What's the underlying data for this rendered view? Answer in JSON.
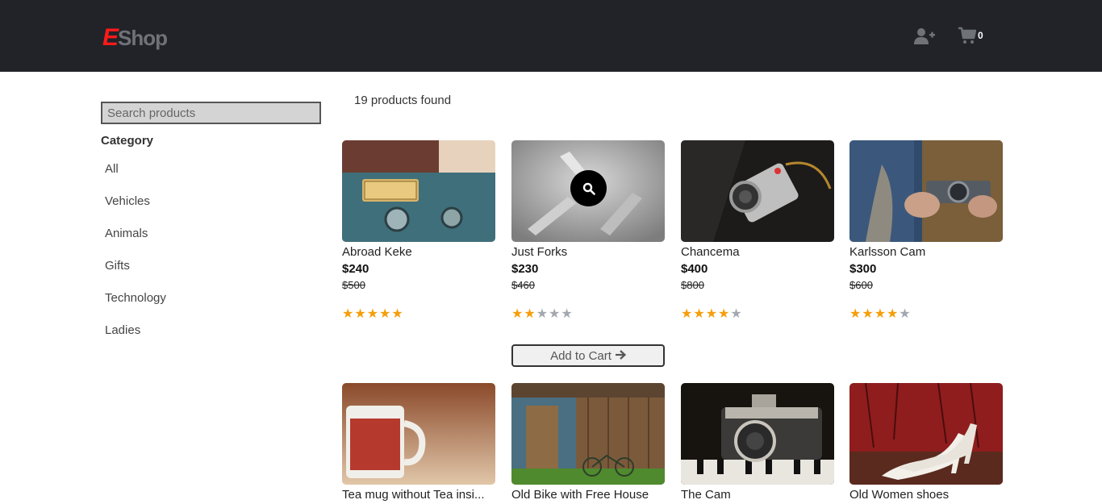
{
  "header": {
    "logo_e": "E",
    "logo_rest": "Shop",
    "cart_count": "0",
    "user_icon": "user-plus-icon",
    "cart_icon": "cart-icon"
  },
  "sidebar": {
    "search_placeholder": "Search products",
    "category_title": "Category",
    "categories": [
      "All",
      "Vehicles",
      "Animals",
      "Gifts",
      "Technology",
      "Ladies"
    ]
  },
  "main": {
    "products_found": "19 products found",
    "add_to_cart_label": "Add to Cart",
    "products": [
      {
        "name": "Abroad Keke",
        "price": "$240",
        "old_price": "$500",
        "rating": 5
      },
      {
        "name": "Just Forks",
        "price": "$230",
        "old_price": "$460",
        "rating": 2
      },
      {
        "name": "Chancema",
        "price": "$400",
        "old_price": "$800",
        "rating": 4
      },
      {
        "name": "Karlsson Cam",
        "price": "$300",
        "old_price": "$600",
        "rating": 4
      },
      {
        "name": "Tea mug without Tea insi...",
        "price": "",
        "old_price": "",
        "rating": 0
      },
      {
        "name": "Old Bike with Free House",
        "price": "",
        "old_price": "",
        "rating": 0
      },
      {
        "name": "The Cam",
        "price": "",
        "old_price": "",
        "rating": 0
      },
      {
        "name": "Old Women shoes",
        "price": "",
        "old_price": "",
        "rating": 0
      }
    ]
  },
  "colors": {
    "navbar": "#212329",
    "logo_e": "#ff1a1a",
    "star_on": "#f59e0b",
    "star_off": "#a3a8b0"
  }
}
